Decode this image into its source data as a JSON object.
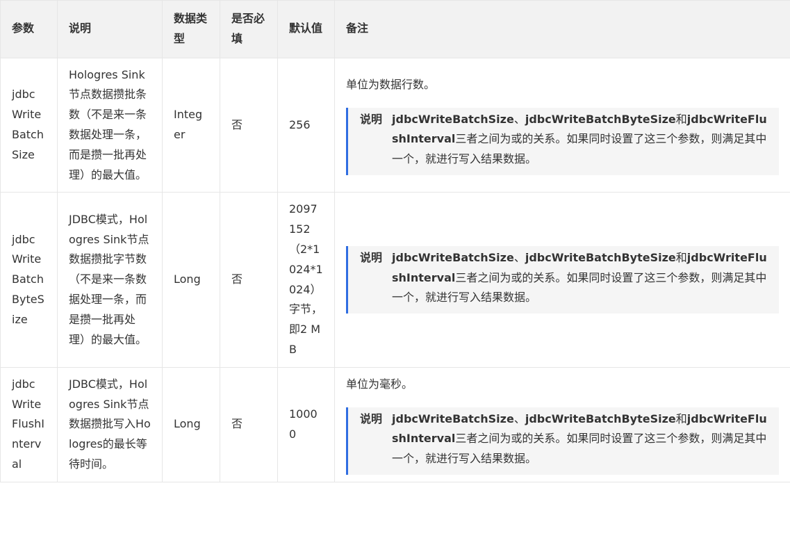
{
  "headers": [
    "参数",
    "说明",
    "数据类型",
    "是否必填",
    "默认值",
    "备注"
  ],
  "rows": [
    {
      "param": "jdbcWriteBatchSize",
      "desc": "Hologres Sink节点数据攒批条数（不是来一条数据处理一条，而是攒一批再处理）的最大值。",
      "type": "Integer",
      "required": "否",
      "default": "256",
      "remark_text": "单位为数据行数。"
    },
    {
      "param": "jdbcWriteBatchByteSize",
      "desc": "JDBC模式，Hologres Sink节点数据攒批字节数（不是来一条数据处理一条，而是攒一批再处理）的最大值。",
      "type": "Long",
      "required": "否",
      "default": "2097152（2*1024*1024）字节，即2 MB",
      "remark_text": ""
    },
    {
      "param": "jdbcWriteFlushInterval",
      "desc": "JDBC模式，Hologres Sink节点数据攒批写入Hologres的最长等待时间。",
      "type": "Long",
      "required": "否",
      "default": "10000",
      "remark_text": "单位为毫秒。"
    }
  ],
  "note": {
    "label": "说明",
    "term1": "jdbcWriteBatchSize",
    "sep1": "、",
    "term2": "jdbcWriteBatchByteSize",
    "sep2": "和",
    "term3": "jdbcWriteFlushInterval",
    "text": "三者之间为或的关系。如果同时设置了这三个参数，则满足其中一个，就进行写入结果数据。"
  },
  "colors": {
    "header_bg": "#f2f2f2",
    "border": "#e6e6e6",
    "note_bg": "#f5f5f5",
    "note_accent": "#2f6de1",
    "text": "#333333"
  }
}
